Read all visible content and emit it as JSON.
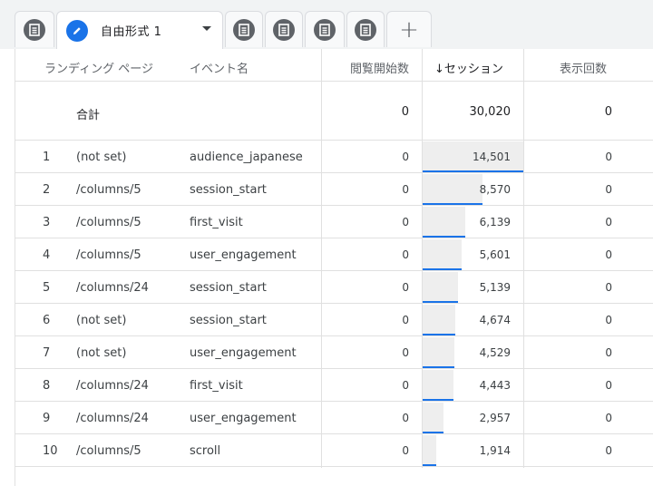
{
  "tabs": {
    "active_label": "自由形式 1",
    "add_icon": "plus-icon",
    "doc_icon": "document-icon",
    "edit_icon": "pencil-icon"
  },
  "table": {
    "headers": {
      "landing_page": "ランディング ページ",
      "event_name": "イベント名",
      "checkout_starts": "閲覧開始数",
      "sessions": "↓セッション",
      "views": "表示回数"
    },
    "totals": {
      "label": "合計",
      "checkout_starts": "0",
      "sessions": "30,020",
      "views": "0"
    },
    "max_sessions": 14501,
    "rows": [
      {
        "rank": "1",
        "page": "(not set)",
        "event": "audience_japanese",
        "checkout_starts": "0",
        "sessions": "14,501",
        "sessions_value": 14501,
        "views": "0"
      },
      {
        "rank": "2",
        "page": "/columns/5",
        "event": "session_start",
        "checkout_starts": "0",
        "sessions": "8,570",
        "sessions_value": 8570,
        "views": "0"
      },
      {
        "rank": "3",
        "page": "/columns/5",
        "event": "first_visit",
        "checkout_starts": "0",
        "sessions": "6,139",
        "sessions_value": 6139,
        "views": "0"
      },
      {
        "rank": "4",
        "page": "/columns/5",
        "event": "user_engagement",
        "checkout_starts": "0",
        "sessions": "5,601",
        "sessions_value": 5601,
        "views": "0"
      },
      {
        "rank": "5",
        "page": "/columns/24",
        "event": "session_start",
        "checkout_starts": "0",
        "sessions": "5,139",
        "sessions_value": 5139,
        "views": "0"
      },
      {
        "rank": "6",
        "page": "(not set)",
        "event": "session_start",
        "checkout_starts": "0",
        "sessions": "4,674",
        "sessions_value": 4674,
        "views": "0"
      },
      {
        "rank": "7",
        "page": "(not set)",
        "event": "user_engagement",
        "checkout_starts": "0",
        "sessions": "4,529",
        "sessions_value": 4529,
        "views": "0"
      },
      {
        "rank": "8",
        "page": "/columns/24",
        "event": "first_visit",
        "checkout_starts": "0",
        "sessions": "4,443",
        "sessions_value": 4443,
        "views": "0"
      },
      {
        "rank": "9",
        "page": "/columns/24",
        "event": "user_engagement",
        "checkout_starts": "0",
        "sessions": "2,957",
        "sessions_value": 2957,
        "views": "0"
      },
      {
        "rank": "10",
        "page": "/columns/5",
        "event": "scroll",
        "checkout_starts": "0",
        "sessions": "1,914",
        "sessions_value": 1914,
        "views": "0"
      }
    ]
  },
  "colors": {
    "accent": "#1a73e8",
    "bar_background": "#eeeeee",
    "border": "#e0e0e0"
  }
}
